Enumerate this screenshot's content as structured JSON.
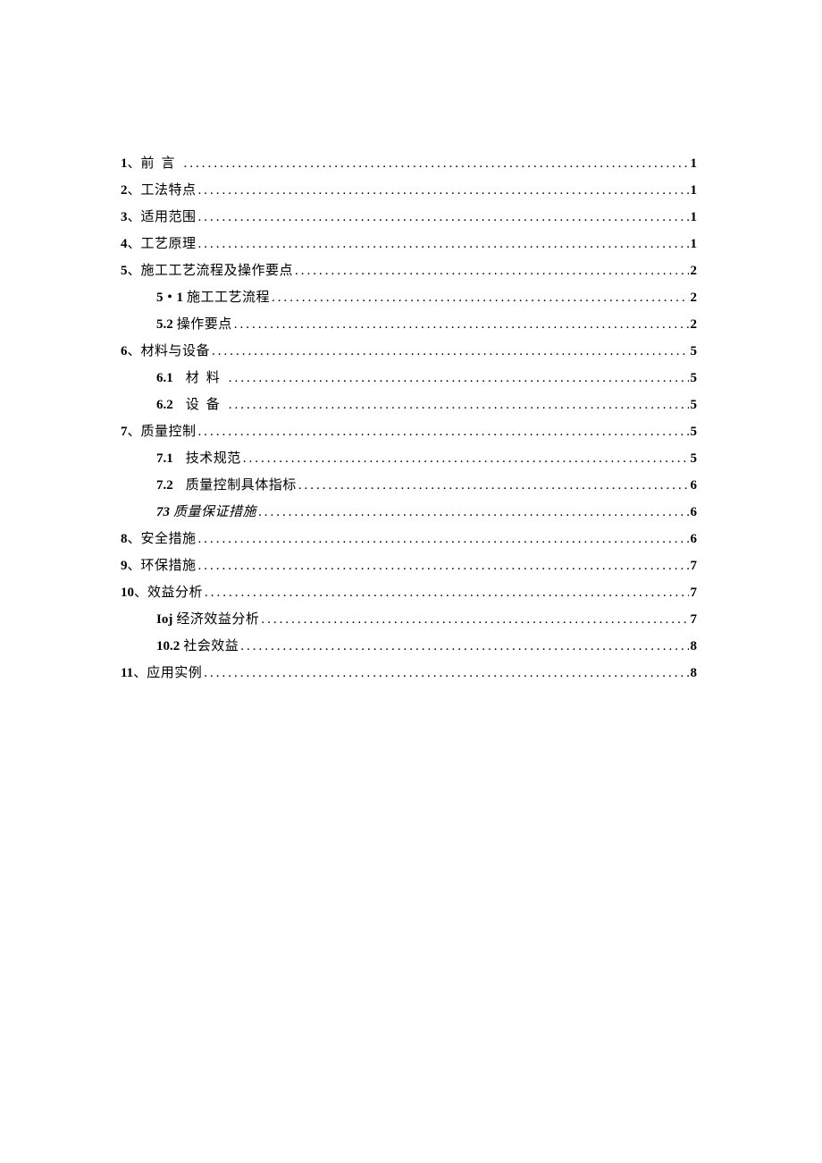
{
  "toc": [
    {
      "level": 0,
      "num": "1",
      "sep": "、",
      "title": "前言",
      "page": "1",
      "spaced": true
    },
    {
      "level": 0,
      "num": "2",
      "sep": "、",
      "title": "工法特点",
      "page": "1"
    },
    {
      "level": 0,
      "num": "3",
      "sep": "、",
      "title": "适用范围",
      "page": "1"
    },
    {
      "level": 0,
      "num": "4",
      "sep": "、",
      "title": "工艺原理",
      "page": "1"
    },
    {
      "level": 0,
      "num": "5",
      "sep": "、",
      "title": "施工工艺流程及操作要点",
      "page": "2"
    },
    {
      "level": 1,
      "subnum": "5・1",
      "title": "施工工艺流程",
      "page": "2"
    },
    {
      "level": 1,
      "subnum": "5.2",
      "title": "操作要点",
      "page": "2"
    },
    {
      "level": 0,
      "num": "6",
      "sep": "、",
      "title": "材料与设备",
      "page": "5"
    },
    {
      "level": 1,
      "subnum": "6.1",
      "title": "材料",
      "page": "5",
      "subgap": true,
      "spaced": true
    },
    {
      "level": 1,
      "subnum": "6.2",
      "title": "设备",
      "page": "5",
      "subgap": true,
      "spaced": true
    },
    {
      "level": 0,
      "num": "7",
      "sep": "、",
      "title": "质量控制",
      "page": "5"
    },
    {
      "level": 1,
      "subnum": "7.1",
      "title": "技术规范",
      "page": "5",
      "subgap": true
    },
    {
      "level": 1,
      "subnum": "7.2",
      "title": "质量控制具体指标",
      "page": "6",
      "subgap": true
    },
    {
      "level": 1,
      "subnum": "73",
      "title": "质量保证措施",
      "page": "6",
      "italic": true
    },
    {
      "level": 0,
      "num": "8",
      "sep": "、",
      "title": "安全措施",
      "page": "6"
    },
    {
      "level": 0,
      "num": "9",
      "sep": "、",
      "title": "环保措施",
      "page": "7"
    },
    {
      "level": 0,
      "num": "10",
      "sep": "、",
      "title": "效益分析",
      "page": "7"
    },
    {
      "level": 1,
      "subnum": "Ioj",
      "title": "经济效益分析",
      "page": "7"
    },
    {
      "level": 1,
      "subnum": "10.2",
      "title": "社会效益",
      "page": "8"
    },
    {
      "level": 0,
      "num": "11",
      "sep": "、",
      "title": "应用实例",
      "page": "8"
    }
  ]
}
